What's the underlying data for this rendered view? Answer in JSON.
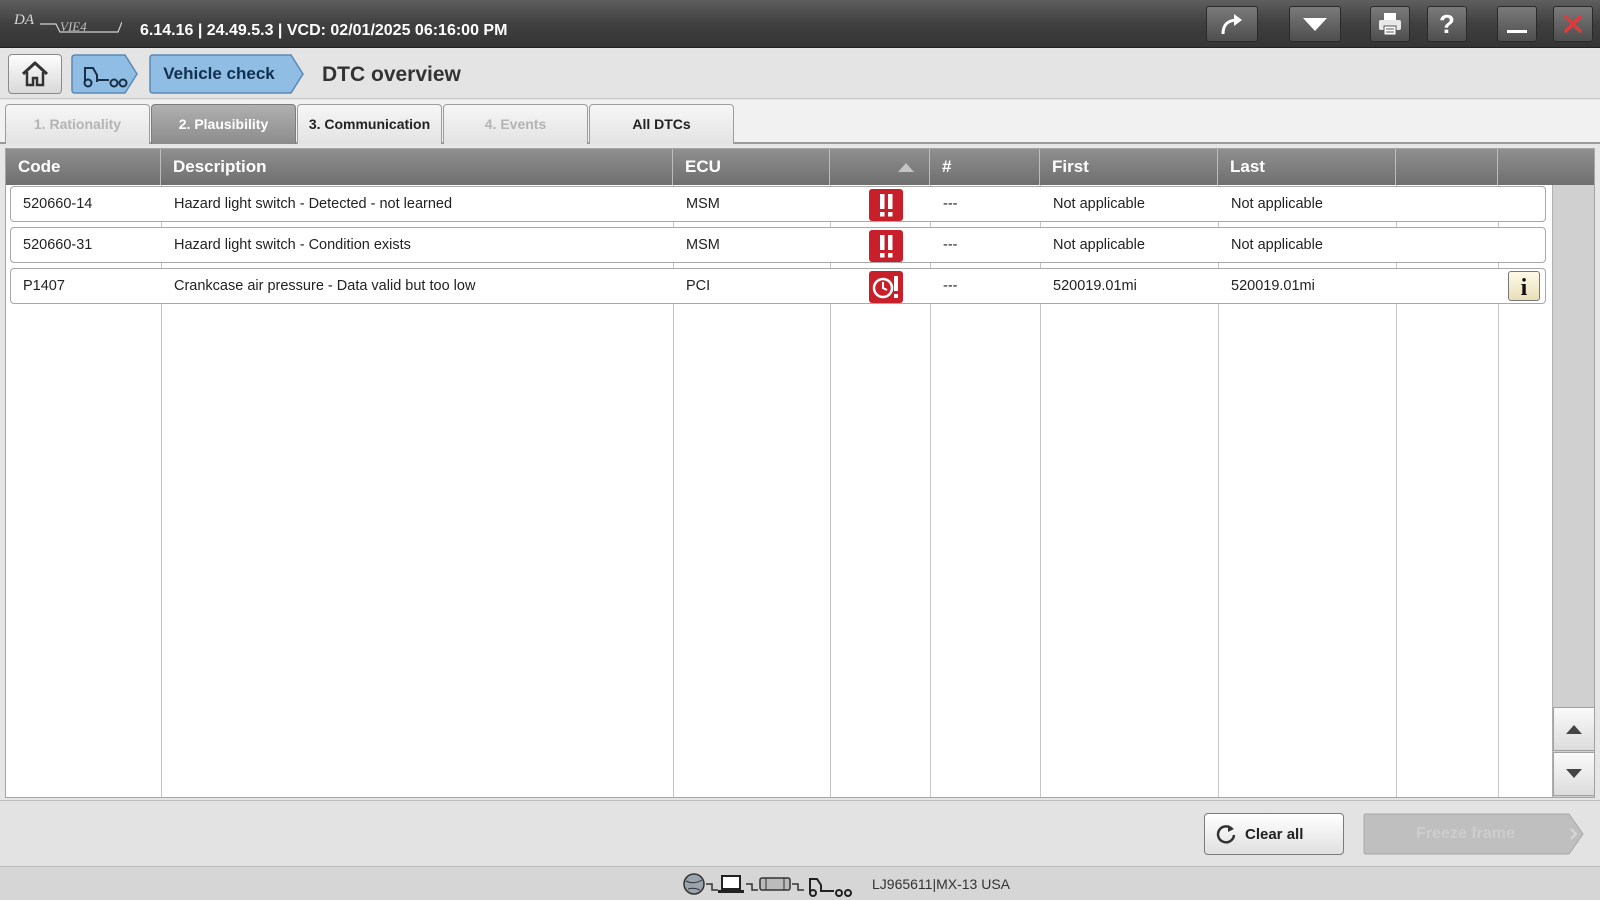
{
  "titlebar": {
    "version": "6.14.16 | 24.49.5.3 | VCD: 02/01/2025 06:16:00 PM",
    "logo_icon": "davie-logo",
    "buttons": [
      "share-arrow-icon",
      "dropdown-arrow-icon",
      "printer-icon",
      "help-icon",
      "minimize-icon",
      "close-icon"
    ]
  },
  "breadcrumb": {
    "home_icon": "home-icon",
    "vehicle_icon": "truck-icon",
    "vehicle_check_label": "Vehicle check",
    "page_title": "DTC overview"
  },
  "tabs": [
    {
      "label": "1. Rationality",
      "state": "disabled"
    },
    {
      "label": "2. Plausibility",
      "state": "active"
    },
    {
      "label": "3. Communication",
      "state": "enabled"
    },
    {
      "label": "4. Events",
      "state": "disabled"
    },
    {
      "label": "All DTCs",
      "state": "enabled"
    }
  ],
  "table": {
    "headers": {
      "code": "Code",
      "description": "Description",
      "ecu": "ECU",
      "severity": "",
      "count": "#",
      "first": "First",
      "last": "Last",
      "extra": ""
    },
    "sort_icon": "sort-ascending-icon",
    "rows": [
      {
        "code": "520660-14",
        "description": "Hazard light switch - Detected - not learned",
        "ecu": "MSM",
        "severity": "warning-exclamation-icon",
        "count": "---",
        "first": "Not applicable",
        "last": "Not applicable",
        "info": false
      },
      {
        "code": "520660-31",
        "description": "Hazard light switch - Condition exists",
        "ecu": "MSM",
        "severity": "warning-exclamation-icon",
        "count": "---",
        "first": "Not applicable",
        "last": "Not applicable",
        "info": false
      },
      {
        "code": "P1407",
        "description": "Crankcase air pressure - Data valid but too low",
        "ecu": "PCI",
        "severity": "clock-warning-icon",
        "count": "---",
        "first": "520019.01mi",
        "last": "520019.01mi",
        "info": true
      }
    ]
  },
  "actions": {
    "clear_all_label": "Clear all",
    "freeze_frame_label": "Freeze frame"
  },
  "status": {
    "vehicle_id": "LJ965611|MX-13 USA"
  },
  "colors": {
    "severity_red": "#c8202a",
    "header_gray": "#7d7d7d",
    "active_tab": "#9a9a9a",
    "vehicle_check_blue": "#8bbbe2"
  }
}
